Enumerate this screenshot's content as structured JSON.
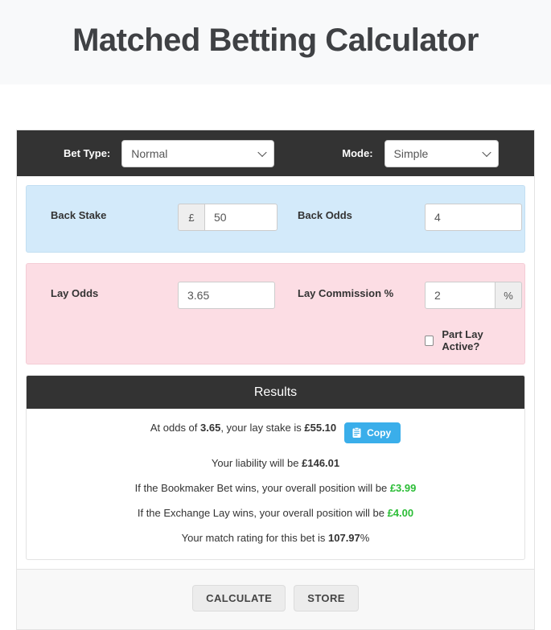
{
  "header": {
    "title": "Matched Betting Calculator"
  },
  "toolbar": {
    "bet_type_label": "Bet Type:",
    "bet_type_value": "Normal",
    "mode_label": "Mode:",
    "mode_value": "Simple"
  },
  "back_section": {
    "stake_label": "Back Stake",
    "stake_currency_addon": "£",
    "stake_value": "50",
    "odds_label": "Back Odds",
    "odds_value": "4"
  },
  "lay_section": {
    "odds_label": "Lay Odds",
    "odds_value": "3.65",
    "commission_label": "Lay Commission %",
    "commission_value": "2",
    "commission_addon": "%",
    "part_lay_label": "Part Lay Active?",
    "part_lay_checked": false
  },
  "results": {
    "title": "Results",
    "lay_stake_prefix": "At odds of ",
    "lay_stake_odds": "3.65",
    "lay_stake_middle": ", your lay stake is ",
    "lay_stake_value": "£55.10",
    "copy_button_label": "Copy",
    "liability_prefix": "Your liability will be ",
    "liability_value": "£146.01",
    "bookmaker_prefix": "If the Bookmaker Bet wins, your overall position will be ",
    "bookmaker_value": "£3.99",
    "exchange_prefix": "If the Exchange Lay wins, your overall position will be ",
    "exchange_value": "£4.00",
    "rating_prefix": "Your match rating for this bet is ",
    "rating_value": "107.97",
    "rating_suffix": "%"
  },
  "footer": {
    "calculate_label": "CALCULATE",
    "store_label": "STORE"
  },
  "colors": {
    "dark_bar": "#333333",
    "back_section": "#d3eafa",
    "lay_section": "#fcdde4",
    "copy_button": "#3aaeea",
    "profit_green": "#2bbd36",
    "page_band": "#f8f9fa"
  }
}
